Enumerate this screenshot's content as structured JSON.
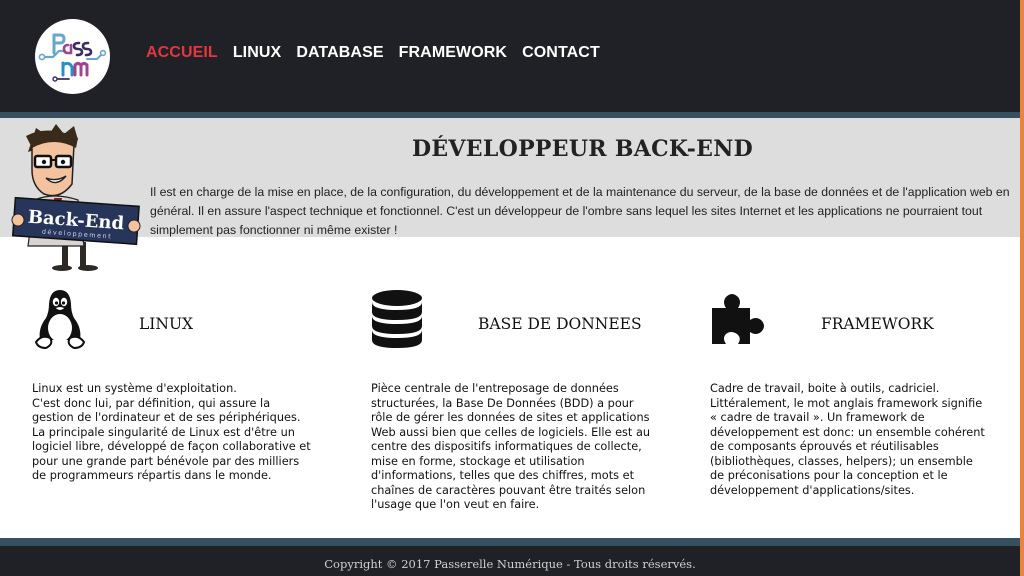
{
  "header": {
    "nav": [
      {
        "label": "ACCUEIL",
        "active": true
      },
      {
        "label": "LINUX",
        "active": false
      },
      {
        "label": "DATABASE",
        "active": false
      },
      {
        "label": "FRAMEWORK",
        "active": false
      },
      {
        "label": "CONTACT",
        "active": false
      }
    ],
    "logo_text": "Passerelle Numérique",
    "active_color": "#e2373f"
  },
  "hero": {
    "title": "DÉVELOPPEUR BACK-END",
    "text": "Il est en charge de la mise en place, de la configuration, du développement et de la maintenance du serveur, de la base de données et de l'application web en général. Il en assure l'aspect technique et fonctionnel. C'est un développeur de l'ombre sans lequel les sites Internet et les applications ne pourraient tout simplement pas fonctionner ni même exister !",
    "mascot_sign": "Back-End",
    "mascot_sub": "développement"
  },
  "columns": [
    {
      "icon": "linux-penguin-icon",
      "title": "LINUX",
      "text": "Linux est un système d'exploitation.\nC'est donc lui, par définition, qui assure la gestion de l'ordinateur et de ses périphériques. La principale singularité de Linux est d'être un logiciel libre, développé de façon collaborative et pour une grande part bénévole par des milliers de programmeurs répartis dans le monde."
    },
    {
      "icon": "database-icon",
      "title": "BASE DE DONNEES",
      "text": "Pièce centrale de l'entreposage de données structurées, la Base De Données (BDD) a pour rôle de gérer les données de sites et applications Web aussi bien que celles de logiciels. Elle est au centre des dispositifs informatiques de collecte, mise en forme, stockage et utilisation d'informations, telles que des chiffres, mots et chaînes de caractères pouvant être traités selon l'usage que l'on veut en faire."
    },
    {
      "icon": "puzzle-icon",
      "title": "FRAMEWORK",
      "text": "Cadre de travail, boite à outils, cadriciel. Littéralement, le mot anglais framework signifie « cadre de travail ». Un framework de développement est donc: un ensemble cohérent de composants éprouvés et réutilisables (bibliothèques, classes, helpers); un ensemble de préconisations pour la conception et le développement d'applications/sites."
    }
  ],
  "footer": {
    "copyright": "Copyright © 2017 Passerelle Numérique - Tous droits réservés."
  }
}
